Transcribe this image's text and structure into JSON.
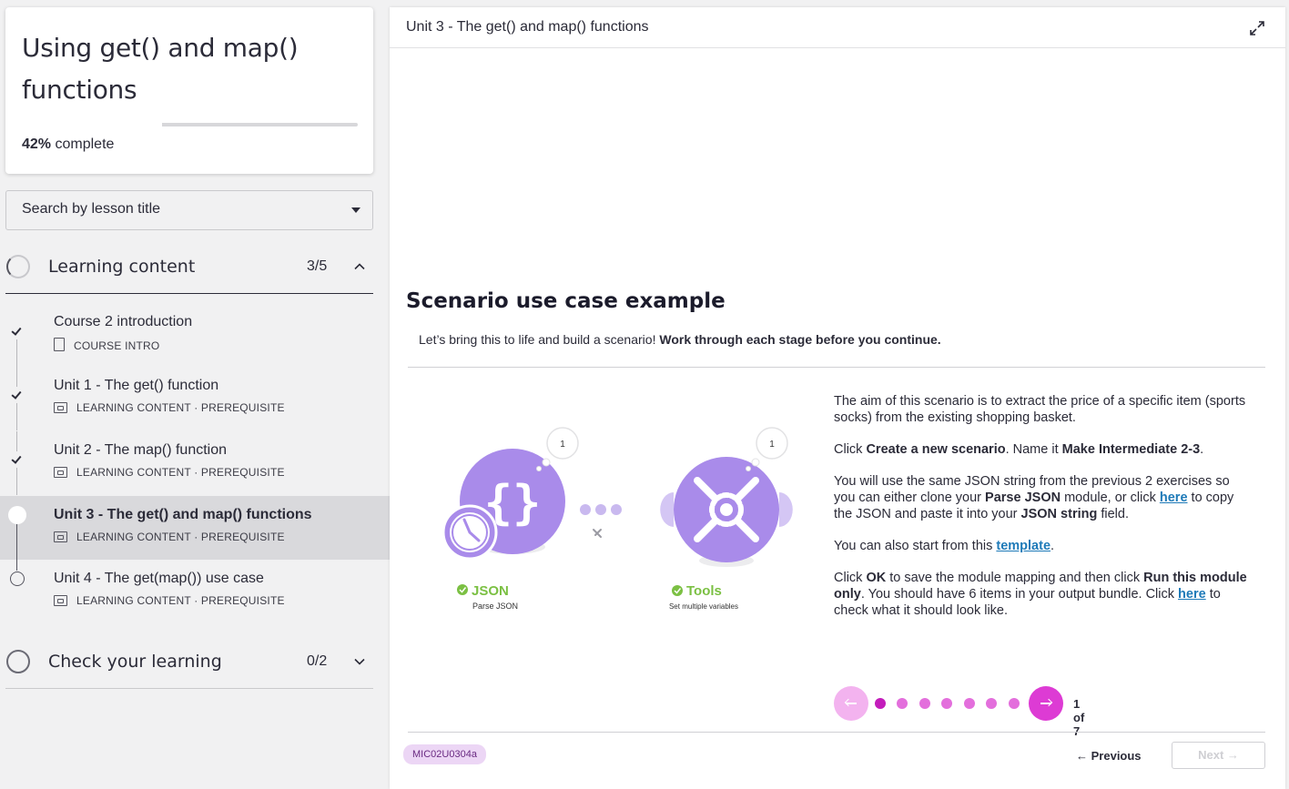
{
  "course": {
    "title": "Using get() and map() functions",
    "progress_percent": 42,
    "progress_pct_label": "42%",
    "progress_suffix": "complete"
  },
  "search": {
    "placeholder": "Search by lesson title"
  },
  "sections": [
    {
      "title": "Learning content",
      "count": "3/5",
      "expanded": true,
      "lessons": [
        {
          "title": "Course 2 introduction",
          "meta": "COURSE INTRO",
          "status": "done"
        },
        {
          "title": "Unit 1 - The get() function",
          "meta": "LEARNING CONTENT · PREREQUISITE",
          "status": "done"
        },
        {
          "title": "Unit 2 - The map() function",
          "meta": "LEARNING CONTENT · PREREQUISITE",
          "status": "done"
        },
        {
          "title": "Unit 3 - The get() and map() functions",
          "meta": "LEARNING CONTENT · PREREQUISITE",
          "status": "current"
        },
        {
          "title": "Unit 4 - The get(map()) use case",
          "meta": "LEARNING CONTENT · PREREQUISITE",
          "status": "todo"
        }
      ]
    },
    {
      "title": "Check your learning",
      "count": "0/2",
      "expanded": false
    }
  ],
  "main": {
    "header_title": "Unit 3 - The get() and map() functions",
    "scenario_title": "Scenario use case example",
    "intro_plain": "Let’s bring this to life and build a scenario! ",
    "intro_bold": "Work through each stage before you continue.",
    "figure": {
      "module1_name": "JSON",
      "module1_sub": "Parse JSON",
      "module1_badge": "1",
      "module2_name": "Tools",
      "module2_sub": "Set multiple variables",
      "module2_badge": "1"
    },
    "desc": {
      "p1": "The aim of this scenario is to extract the price of a specific item (sports socks) from the existing shopping basket.",
      "p2_a": "Click ",
      "p2_b": "Create a new scenario",
      "p2_c": ". Name it ",
      "p2_d": "Make Intermediate 2-3",
      "p2_e": ".",
      "p3_a": "You will use the same JSON string from the previous 2 exercises so you can either clone your ",
      "p3_b": "Parse JSON",
      "p3_c": " module, or click ",
      "p3_link": "here",
      "p3_d": " to copy the JSON and paste it into your ",
      "p3_e": "JSON string",
      "p3_f": " field.",
      "p4_a": "You can also start from this ",
      "p4_link": "template",
      "p4_b": ".",
      "p5_a": "Click ",
      "p5_b": "OK",
      "p5_c": " to save the module mapping and then click ",
      "p5_d": "Run this module only",
      "p5_e": ". You should have 6 items in your output bundle. Click ",
      "p5_link": "here",
      "p5_f": " to check what it should look like."
    },
    "pager": {
      "current": 1,
      "total": 7,
      "label": "1 of 7"
    },
    "code_badge": "MIC02U0304a",
    "previous_label": "Previous",
    "next_label": "Next"
  },
  "colors": {
    "accent_pink": "#dd3bd4",
    "module_purple": "#a98bea",
    "make_green": "#7bc043",
    "link_blue": "#1e7ab8"
  }
}
